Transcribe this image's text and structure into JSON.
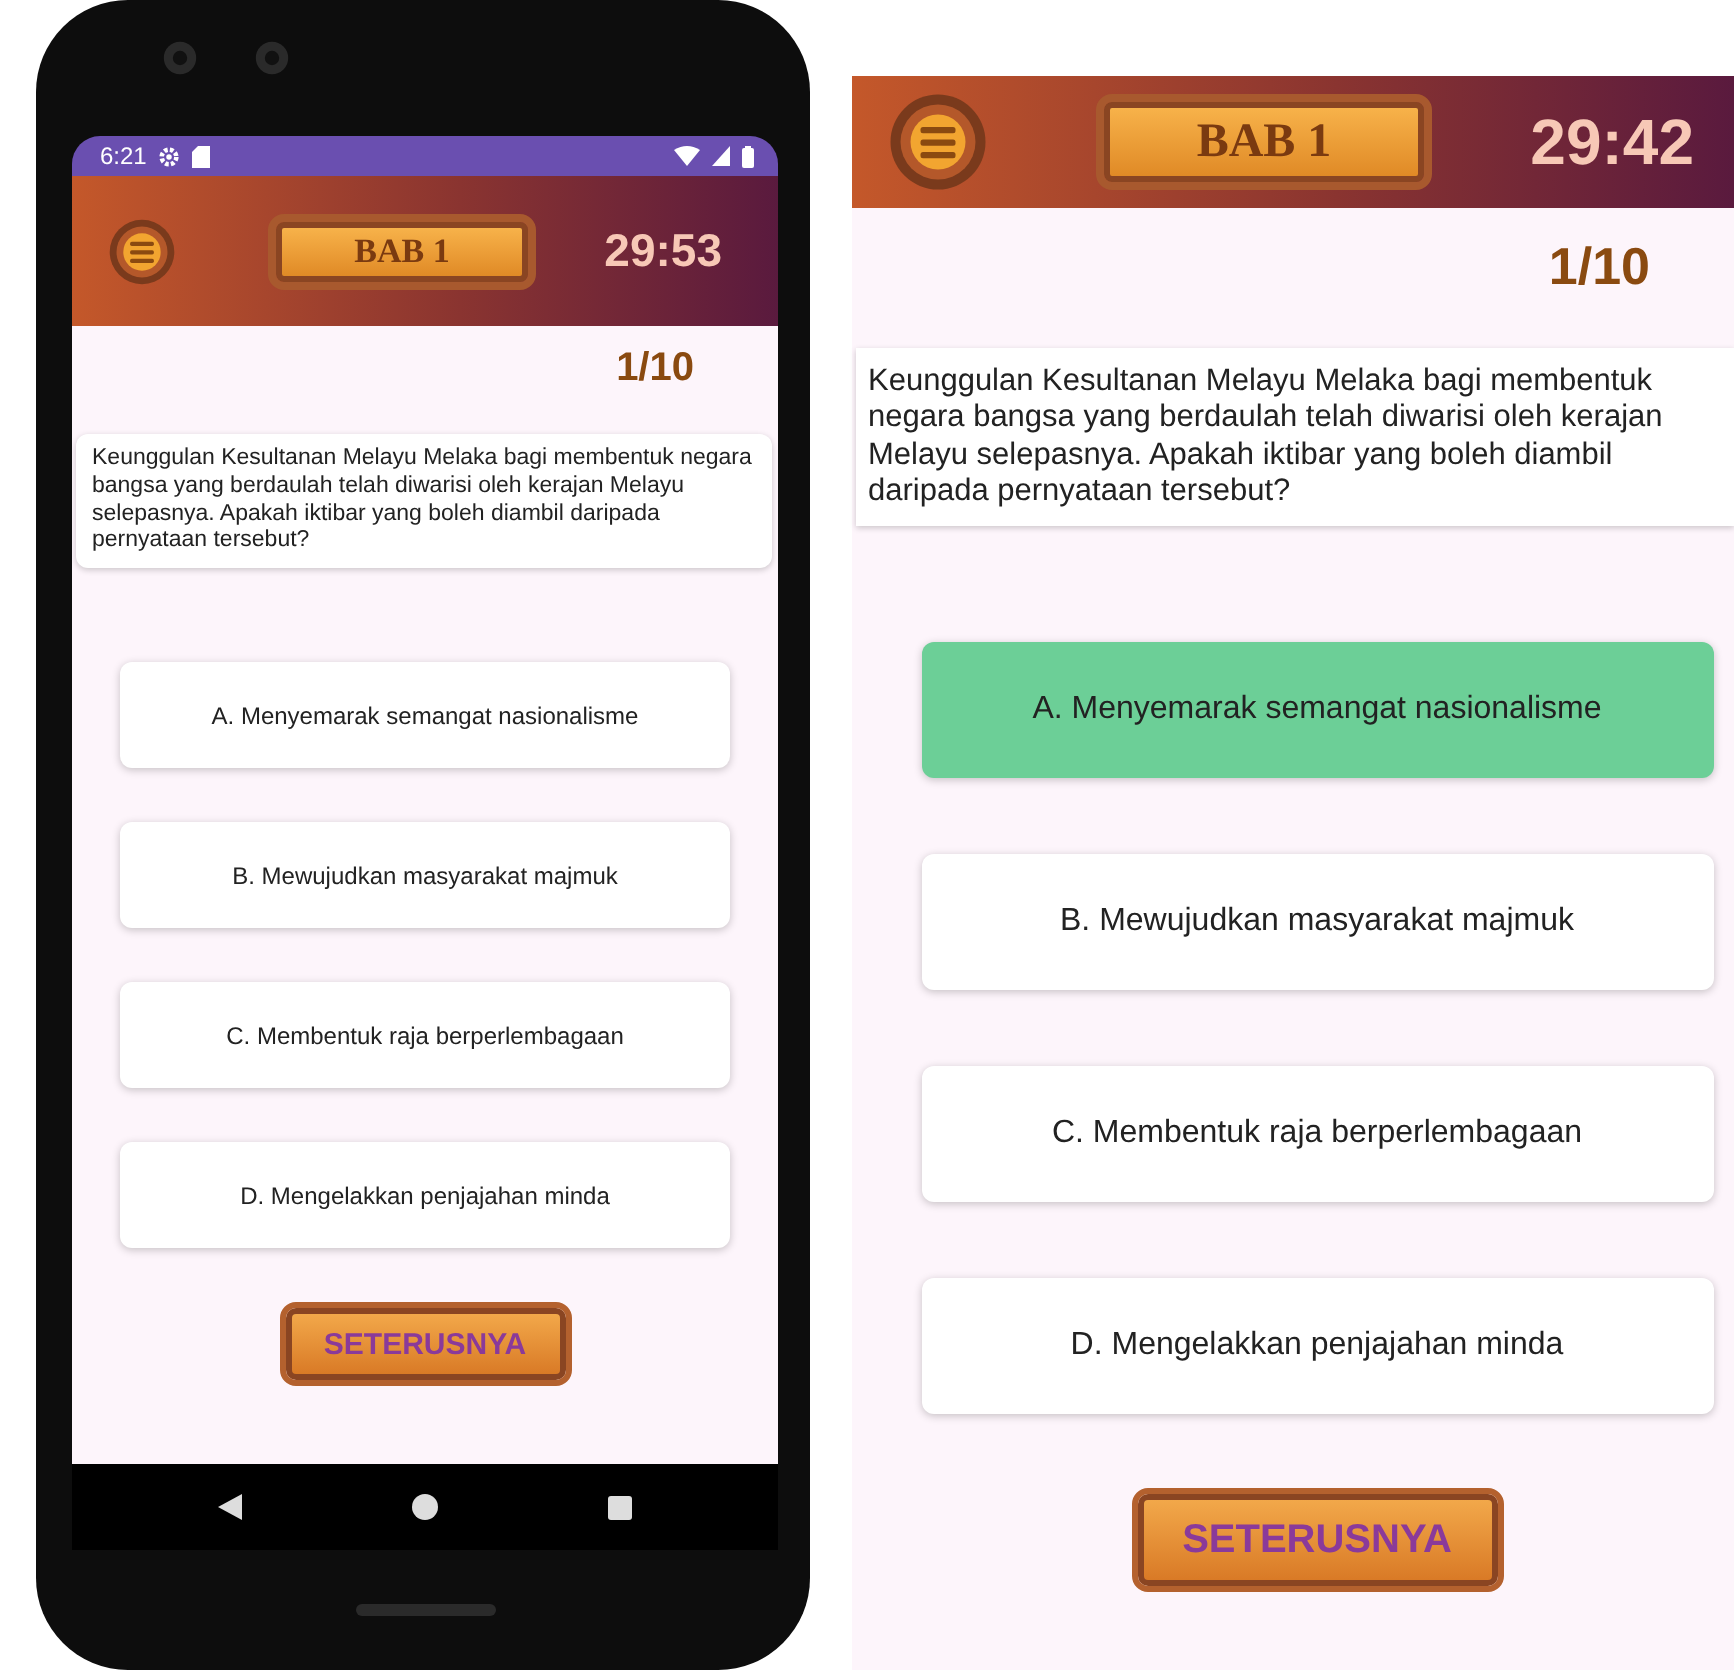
{
  "screens": [
    {
      "kind": "phone",
      "status_bar": {
        "time": "6:21"
      },
      "chapter": "BAB 1",
      "timer": "29:53",
      "progress": "1/10",
      "question": "Keunggulan Kesultanan Melayu Melaka bagi membentuk negara bangsa yang berdaulah telah diwarisi oleh kerajan Melayu selepasnya. Apakah iktibar yang boleh diambil daripada pernyataan tersebut?",
      "options": [
        {
          "label": "A. Menyemarak semangat nasionalisme",
          "selected": false
        },
        {
          "label": "B. Mewujudkan masyarakat majmuk",
          "selected": false
        },
        {
          "label": "C. Membentuk raja berperlembagaan",
          "selected": false
        },
        {
          "label": "D. Mengelakkan penjajahan minda",
          "selected": false
        }
      ],
      "next_button": "SETERUSNYA"
    },
    {
      "kind": "zoom",
      "chapter": "BAB 1",
      "timer": "29:42",
      "progress": "1/10",
      "question": "Keunggulan Kesultanan Melayu Melaka bagi membentuk negara bangsa yang berdaulah telah diwarisi oleh kerajan Melayu selepasnya. Apakah iktibar yang boleh diambil daripada pernyataan tersebut?",
      "options": [
        {
          "label": "A. Menyemarak semangat nasionalisme",
          "selected": true
        },
        {
          "label": "B. Mewujudkan masyarakat majmuk",
          "selected": false
        },
        {
          "label": "C. Membentuk raja berperlembagaan",
          "selected": false
        },
        {
          "label": "D. Mengelakkan penjajahan minda",
          "selected": false
        }
      ],
      "next_button": "SETERUSNYA"
    }
  ]
}
